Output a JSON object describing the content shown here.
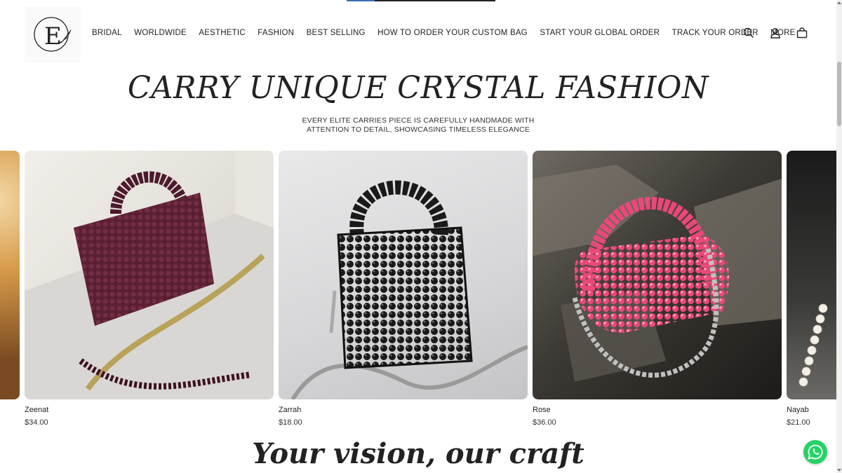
{
  "brand": {
    "logo_letters": "E",
    "logo_alt": "Elite Carries"
  },
  "nav": {
    "items": [
      {
        "label": "BRIDAL"
      },
      {
        "label": "WORLDWIDE"
      },
      {
        "label": "AESTHETIC"
      },
      {
        "label": "FASHION"
      },
      {
        "label": "BEST SELLING"
      },
      {
        "label": "HOW TO ORDER YOUR CUSTOM BAG"
      },
      {
        "label": "START YOUR GLOBAL ORDER"
      },
      {
        "label": "TRACK YOUR ORDER"
      },
      {
        "label": "MORE"
      }
    ]
  },
  "header_icons": [
    "search-icon",
    "account-icon",
    "cart-icon"
  ],
  "hero": {
    "title": "CARRY UNIQUE CRYSTAL FASHION",
    "subtitle_line1": "EVERY ELITE CARRIES PIECE IS CAREFULLY HANDMADE WITH",
    "subtitle_line2": "ATTENTION TO DETAIL, SHOWCASING TIMELESS ELEGANCE"
  },
  "products": [
    {
      "name": "Zeenat",
      "price": "$34.00",
      "bag_color": "#5a1f33"
    },
    {
      "name": "Zarrah",
      "price": "$18.00",
      "bag_color": "#111111"
    },
    {
      "name": "Rose",
      "price": "$36.00",
      "bag_color": "#e8487a"
    },
    {
      "name": "Nayab",
      "price": "$21.00",
      "bag_color": "#f4efe6"
    }
  ],
  "section": {
    "title": "Your vision, our craft"
  },
  "colors": {
    "text": "#1a1a1a",
    "whatsapp": "#25d366"
  }
}
